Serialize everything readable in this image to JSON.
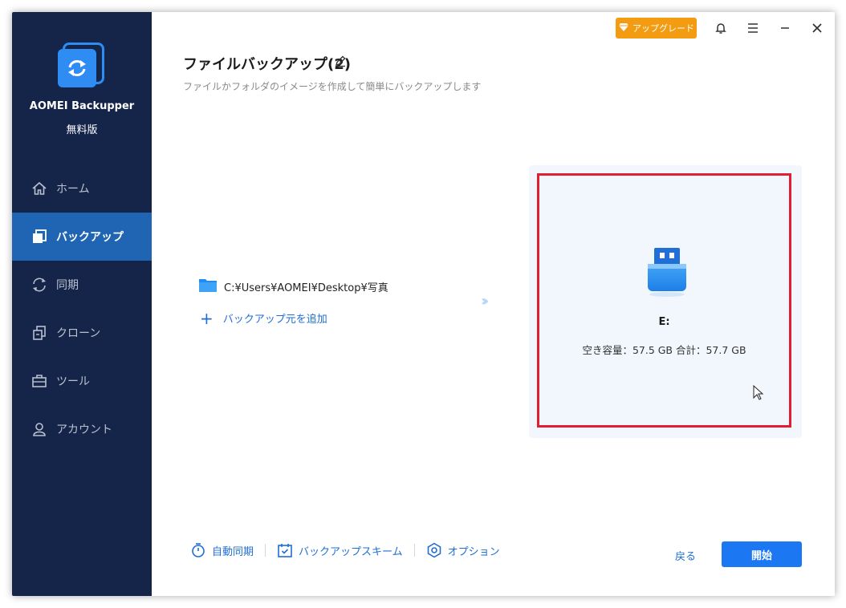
{
  "app": {
    "name": "AOMEI Backupper",
    "edition": "無料版"
  },
  "sidebar": {
    "items": [
      {
        "label": "ホーム",
        "icon": "home-icon",
        "active": false
      },
      {
        "label": "バックアップ",
        "icon": "backup-icon",
        "active": true
      },
      {
        "label": "同期",
        "icon": "sync-icon",
        "active": false
      },
      {
        "label": "クローン",
        "icon": "clone-icon",
        "active": false
      },
      {
        "label": "ツール",
        "icon": "tools-icon",
        "active": false
      },
      {
        "label": "アカウント",
        "icon": "account-icon",
        "active": false
      }
    ]
  },
  "titlebar": {
    "upgrade_label": "アップグレード"
  },
  "page": {
    "title": "ファイルバックアップ(2)",
    "subtitle": "ファイルかフォルダのイメージを作成して簡単にバックアップします"
  },
  "source": {
    "path": "C:¥Users¥AOMEI¥Desktop¥写真",
    "add_label": "バックアップ元を追加"
  },
  "destination": {
    "drive": "E:",
    "space": "空き容量：57.5 GB 合計：57.7 GB"
  },
  "footer": {
    "auto_sync": "自動同期",
    "scheme": "バックアップスキーム",
    "options": "オプション",
    "back": "戻る",
    "start": "開始"
  },
  "colors": {
    "sidebar_bg": "#15254a",
    "active_nav": "#2065b4",
    "accent": "#1b78f2",
    "upgrade": "#f39c12",
    "highlight_border": "#e02030"
  }
}
